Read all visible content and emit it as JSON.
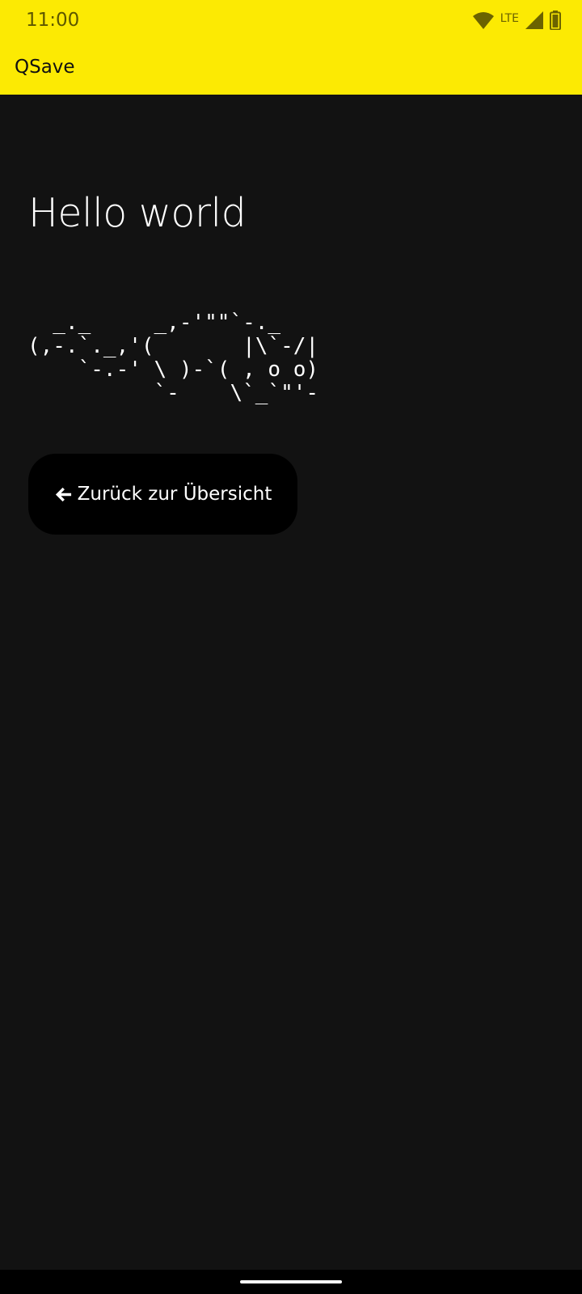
{
  "status_bar": {
    "time": "11:00",
    "network": "LTE",
    "icons": [
      "wifi-icon",
      "cell-signal-icon",
      "battery-icon"
    ]
  },
  "app_bar": {
    "title": "QSave"
  },
  "main": {
    "heading": "Hello world",
    "ascii_art": "  _._     _,-'\"\"`-._\n(,-.`._,'(       |\\`-/|\n    `-.-' \\ )-`( , o o)\n          `-    \\`_`\"'-",
    "back_button_label": "Zurück zur Übersicht",
    "back_button_icon": "arrow-left-icon"
  },
  "colors": {
    "accent": "#fcea03",
    "background": "#121212",
    "button": "#000000",
    "text": "#ffffff"
  }
}
